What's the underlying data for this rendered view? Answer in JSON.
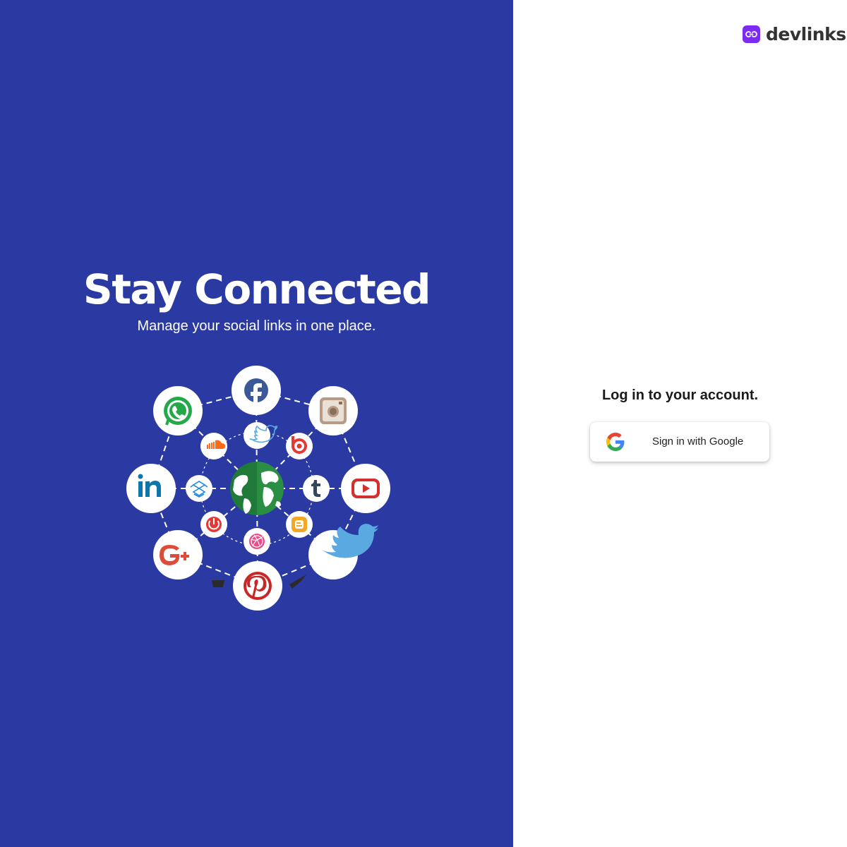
{
  "hero": {
    "title": "Stay Connected",
    "subtitle": "Manage your social links in one place."
  },
  "illustration": {
    "center_icon": "globe-icon",
    "outer_icons": [
      "facebook-icon",
      "instagram-icon",
      "youtube-icon",
      "twitter-icon",
      "pinterest-icon",
      "google-plus-icon",
      "linkedin-icon",
      "whatsapp-icon"
    ],
    "inner_icons": [
      "twitter-icon",
      "beats-icon",
      "tumblr-icon",
      "blogger-icon",
      "dribbble-icon",
      "power-icon",
      "dropbox-icon",
      "soundcloud-icon"
    ]
  },
  "brand": {
    "name": "devlinks",
    "accent": "#7c2bf2"
  },
  "login": {
    "heading": "Log in to your account.",
    "google_button_label": "Sign in with Google"
  },
  "colors": {
    "left_panel": "#2a3aa2",
    "right_panel": "#ffffff"
  }
}
